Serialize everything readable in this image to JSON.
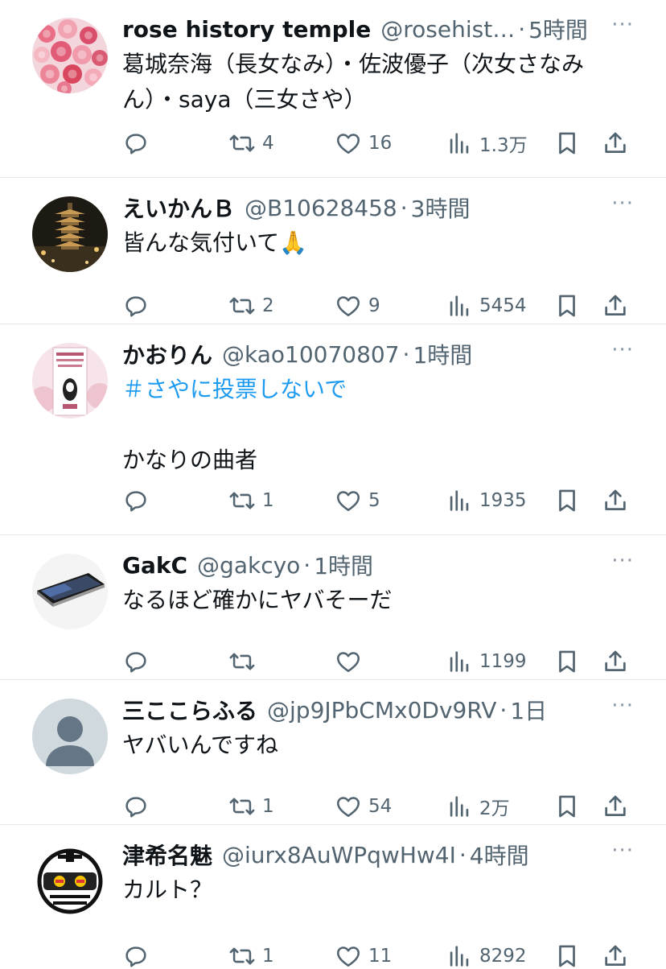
{
  "posts": [
    {
      "name": "rose history temple",
      "handle": "@rosehist…",
      "time": "5時間",
      "text": "葛城奈海（長女なみ）・佐波優子（次女さなみん）・saya（三女さや）",
      "hashtag": "",
      "replies": "",
      "reposts": "4",
      "likes": "16",
      "views": "1.3万",
      "avatar": "rose-flowers"
    },
    {
      "name": "えいかんＢ",
      "handle": "@B10628458",
      "time": "3時間",
      "text": "皆んな気付いて🙏",
      "hashtag": "",
      "replies": "",
      "reposts": "2",
      "likes": "9",
      "views": "5454",
      "avatar": "pagoda-night"
    },
    {
      "name": "かおりん",
      "handle": "@kao10070807",
      "time": "1時間",
      "hashtag": "＃さやに投票しないで",
      "text": "\nかなりの曲者",
      "replies": "",
      "reposts": "1",
      "likes": "5",
      "views": "1935",
      "avatar": "poster-pink"
    },
    {
      "name": "GakC",
      "handle": "@gakcyo",
      "time": "1時間",
      "text": "なるほど確かにヤバそーだ",
      "hashtag": "",
      "replies": "",
      "reposts": "",
      "likes": "",
      "views": "1199",
      "avatar": "smartphone"
    },
    {
      "name": "三ここらふる",
      "handle": "@jp9JPbCMx0Dv9RV",
      "time": "1日",
      "text": "ヤバいんですね",
      "hashtag": "",
      "replies": "",
      "reposts": "1",
      "likes": "54",
      "views": "2万",
      "avatar": "default-user"
    },
    {
      "name": "津希名魅",
      "handle": "@iurx8AuWPqwHw4I",
      "time": "4時間",
      "text": "カルト？",
      "hashtag": "",
      "replies": "",
      "reposts": "1",
      "likes": "11",
      "views": "8292",
      "avatar": "robot-face"
    }
  ],
  "ui": {
    "dot": "·",
    "more": "···"
  },
  "icons": {
    "reply": "reply-icon",
    "repost": "repost-icon",
    "like": "heart-icon",
    "views": "views-icon",
    "bookmark": "bookmark-icon",
    "share": "share-icon"
  },
  "colors": {
    "text": "#0f1419",
    "muted": "#536471",
    "link": "#1d9bf0",
    "divider": "#e6e9ec"
  }
}
